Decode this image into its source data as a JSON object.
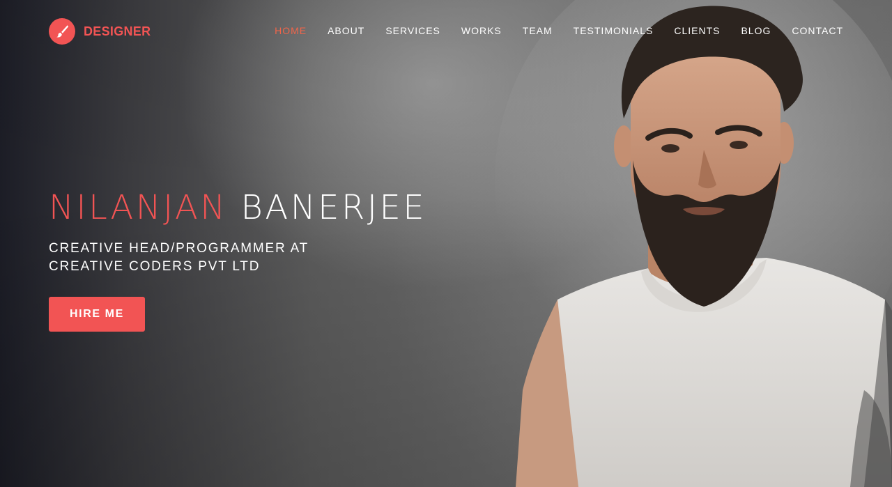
{
  "brand": {
    "name": "DESIGNER",
    "icon": "paintbrush-icon",
    "color": "#f25454"
  },
  "nav": {
    "items": [
      {
        "label": "HOME",
        "active": true
      },
      {
        "label": "ABOUT"
      },
      {
        "label": "SERVICES"
      },
      {
        "label": "WORKS"
      },
      {
        "label": "TEAM"
      },
      {
        "label": "TESTIMONIALS"
      },
      {
        "label": "CLIENTS"
      },
      {
        "label": "BLOG"
      },
      {
        "label": "CONTACT"
      }
    ],
    "active_color": "#f0654a"
  },
  "hero": {
    "first_name": "NILANJAN",
    "last_name": "BANERJEE",
    "role_line1": "CREATIVE HEAD/PROGRAMMER AT",
    "role_line2": "CREATIVE CODERS PVT LTD",
    "cta_label": "HIRE ME",
    "accent": "#f25454"
  }
}
